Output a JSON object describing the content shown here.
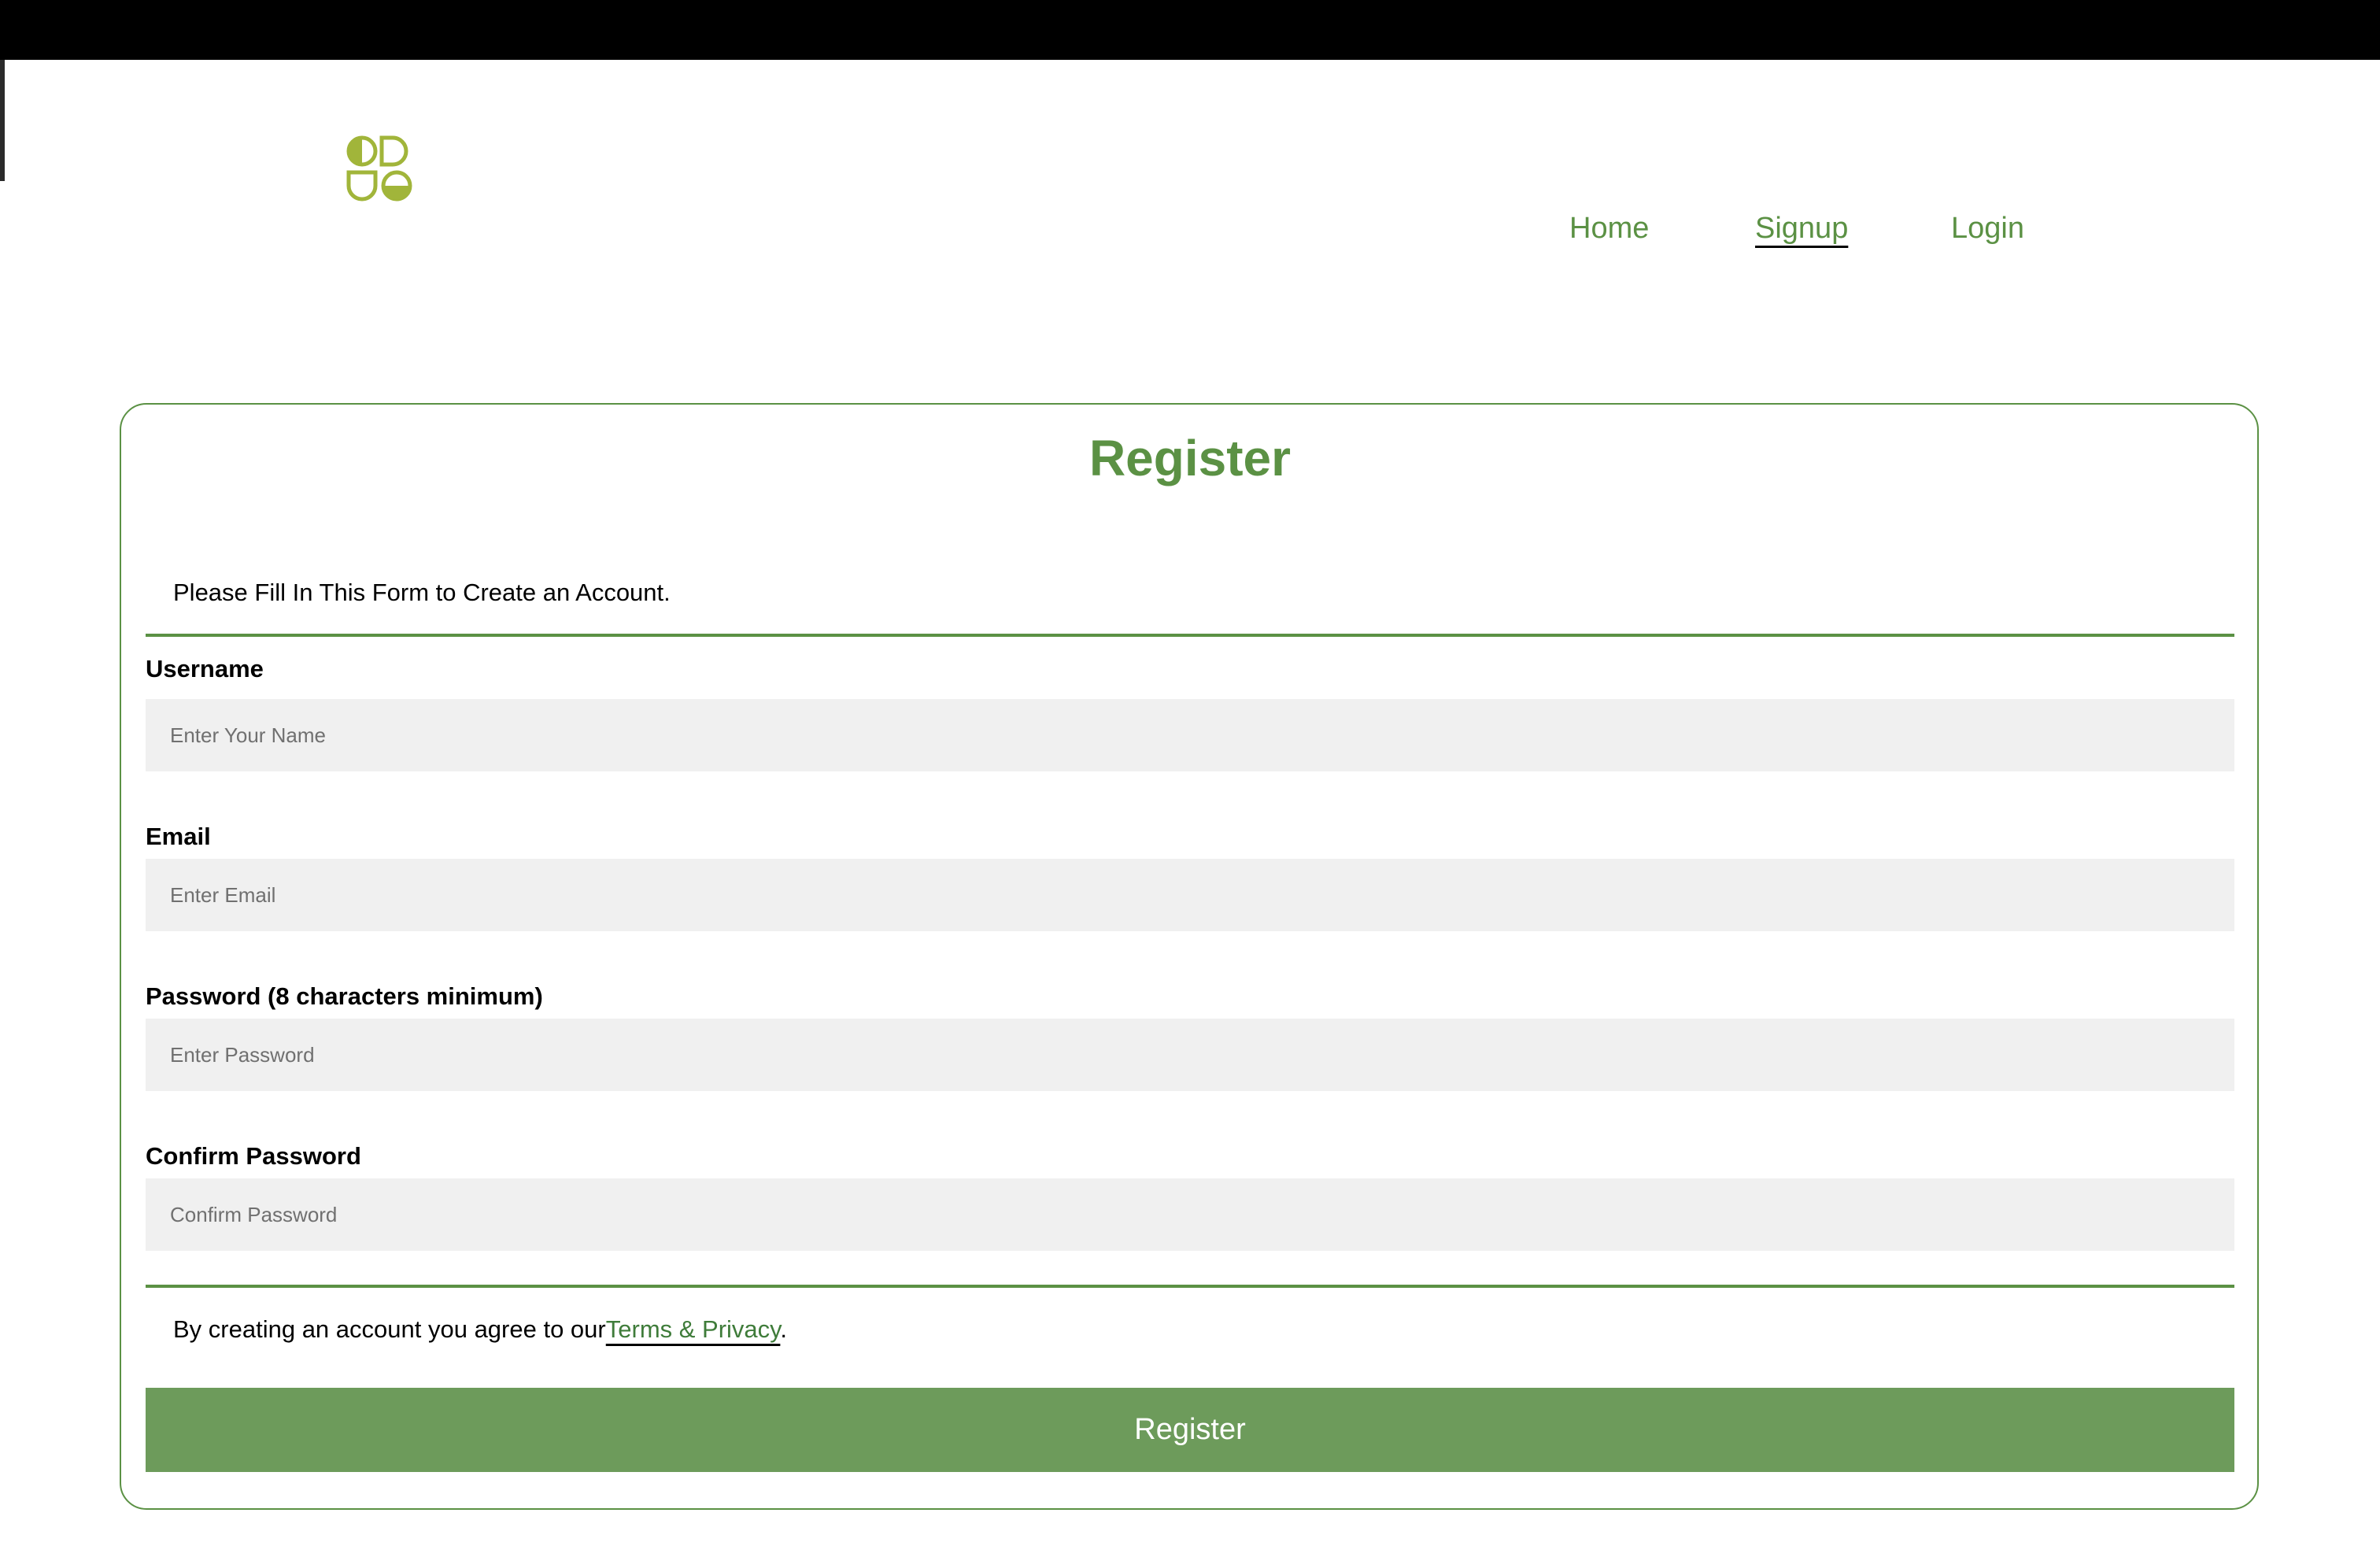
{
  "nav": {
    "items": [
      {
        "label": "Home",
        "active": false
      },
      {
        "label": "Signup",
        "active": true
      },
      {
        "label": "Login",
        "active": false
      }
    ]
  },
  "form": {
    "title": "Register",
    "intro": "Please Fill In This Form to Create an Account.",
    "fields": [
      {
        "label": "Username",
        "placeholder": "Enter Your Name",
        "value": ""
      },
      {
        "label": "Email",
        "placeholder": "Enter Email",
        "value": ""
      },
      {
        "label": "Password (8 characters minimum)",
        "placeholder": "Enter Password",
        "value": ""
      },
      {
        "label": "Confirm Password",
        "placeholder": "Confirm Password",
        "value": ""
      }
    ],
    "terms_prefix": "By creating an account you agree to our",
    "terms_link": "Terms & Privacy",
    "terms_suffix": ".",
    "submit_label": "Register"
  },
  "colors": {
    "accent": "#5b9144",
    "button": "#6d9b5b",
    "input_bg": "#f0f0f0",
    "logo": "#a1b53a"
  }
}
